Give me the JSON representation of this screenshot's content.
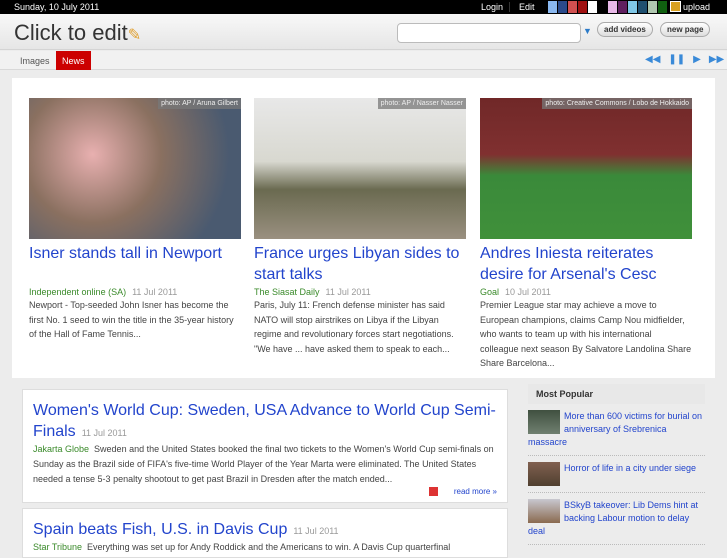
{
  "topbar": {
    "date": "Sunday, 10 July 2011",
    "login": "Login",
    "edit": "Edit",
    "upload": "upload",
    "swatches": [
      "#8ab8f0",
      "#2a4a8a",
      "#d05050",
      "#a01010",
      "#ffffff",
      "#000000",
      "#e8b8e8",
      "#602060",
      "#80c8e8",
      "#205070",
      "#b0c8b0",
      "#106010"
    ]
  },
  "header": {
    "title": "Click to edit",
    "search_value": "",
    "add_videos": "add videos",
    "new_page": "new page"
  },
  "nav": {
    "tabs": [
      {
        "label": "Images"
      },
      {
        "label": "News"
      }
    ]
  },
  "featured": [
    {
      "credit": "photo: AP / Aruna Gilbert",
      "title": "Isner stands tall in Newport",
      "source": "Independent online (SA)",
      "date": "11 Jul 2011",
      "snippet": "Newport - Top-seeded John Isner has become the first No. 1 seed to win the title in the 35-year history of the Hall of Fame Tennis..."
    },
    {
      "credit": "photo: AP / Nasser Nasser",
      "title": "France urges Libyan sides to start talks",
      "source": "The Siasat Daily",
      "date": "11 Jul 2011",
      "snippet": "Paris, July 11: French defense minister has said NATO will stop airstrikes on Libya if the Libyan regime and revolutionary forces start negotiations. \"We have ... have asked them to speak to each..."
    },
    {
      "credit": "photo: Creative Commons / Lobo de Hokkaido",
      "title": "Andres Iniesta reiterates desire for Arsenal's Cesc",
      "source": "Goal",
      "date": "10 Jul 2011",
      "snippet": "Premier League star may achieve a move to European champions, claims Camp Nou midfielder, who wants to team up with his international colleague next season By Salvatore Landolina Share Share Barcelona..."
    }
  ],
  "articles": [
    {
      "title": "Women's World Cup: Sweden, USA Advance to World Cup Semi-Finals",
      "date": "11 Jul 2011",
      "source": "Jakarta Globe",
      "snippet": "Sweden and the United States booked the final two tickets to the Women's World Cup semi-finals on Sunday as the Brazil side of FIFA's five-time World Player of the Year Marta were eliminated. The United States needed a tense 5-3 penalty shootout to get past Brazil in Dresden after the match ended...",
      "read_more": "read more"
    },
    {
      "title": "Spain beats Fish, U.S. in Davis Cup",
      "date": "11 Jul 2011",
      "source": "Star Tribune",
      "snippet": "Everything was set up for Andy Roddick and the Americans to win. A Davis Cup quarterfinal"
    }
  ],
  "sidebar": {
    "heading": "Most Popular",
    "items": [
      {
        "title": "More than 600 victims for burial on anniversary of Srebrenica massacre"
      },
      {
        "title": "Horror of life in a city under siege"
      },
      {
        "title": "BSkyB takeover: Lib Dems hint at backing Labour motion to delay deal"
      }
    ]
  }
}
